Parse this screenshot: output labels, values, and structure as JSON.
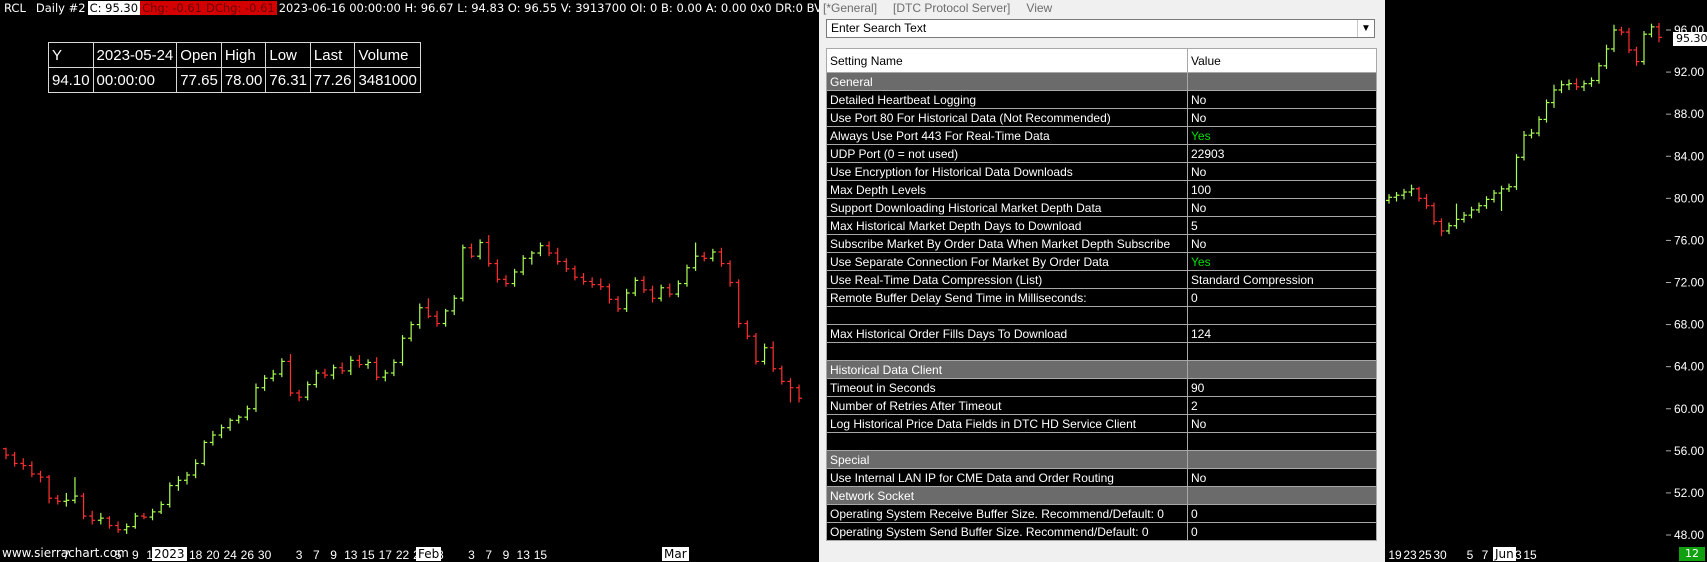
{
  "header": {
    "symbol": "RCL",
    "chart_label": "Daily #2",
    "close": "C: 95.30",
    "change": "Chg: -0.61",
    "dchange": "DChg: -0.61",
    "stats": "2023-06-16 00:00:00 H: 96.67 L: 94.83 O: 96.55 V: 3913700 OI: 0 B: 0.00 A: 0.00 0x0 DR:0 BV: 0 AV: 0 DV: 0"
  },
  "data_box": {
    "headers": [
      "Y",
      "2023-05-24",
      "Open",
      "High",
      "Low",
      "Last",
      "Volume"
    ],
    "values": [
      "94.10",
      "00:00:00",
      "77.65",
      "78.00",
      "76.31",
      "77.26",
      "3481000"
    ]
  },
  "watermark": "www.sierrachart.com",
  "highlighted_labels": {
    "year": "2023",
    "feb": "Feb",
    "mar": "Mar",
    "jun": "Jun"
  },
  "badge": "12",
  "current_price": "95.30",
  "colors": {
    "up": "#aaff55",
    "down": "#ff3030",
    "neg_bg": "#d40000",
    "yes": "#00e000",
    "section": "#6b6b6b"
  },
  "chart_data": {
    "type": "bar",
    "ylim": [
      46,
      98
    ],
    "y_ticks": [
      "96.00",
      "92.00",
      "88.00",
      "84.00",
      "80.00",
      "76.00",
      "72.00",
      "68.00",
      "64.00",
      "60.00",
      "56.00",
      "52.00",
      "48.00"
    ],
    "x_tick_labels": [
      {
        "label": "7",
        "at": 7
      },
      {
        "label": "2023",
        "at": 10
      },
      {
        "label": "5",
        "at": 13
      },
      {
        "label": "9",
        "at": 15
      },
      {
        "label": "11",
        "at": 17
      },
      {
        "label": "13",
        "at": 19
      },
      {
        "label": "18",
        "at": 22
      },
      {
        "label": "20",
        "at": 24
      },
      {
        "label": "24",
        "at": 26
      },
      {
        "label": "26",
        "at": 28
      },
      {
        "label": "30",
        "at": 30
      },
      {
        "label": "Feb",
        "at": 32
      },
      {
        "label": "3",
        "at": 34
      },
      {
        "label": "7",
        "at": 36
      },
      {
        "label": "9",
        "at": 38
      },
      {
        "label": "13",
        "at": 40
      },
      {
        "label": "15",
        "at": 42
      },
      {
        "label": "17",
        "at": 44
      },
      {
        "label": "22",
        "at": 46
      },
      {
        "label": "24",
        "at": 48
      },
      {
        "label": "28",
        "at": 50
      },
      {
        "label": "Mar",
        "at": 52
      },
      {
        "label": "3",
        "at": 54
      },
      {
        "label": "7",
        "at": 56
      },
      {
        "label": "9",
        "at": 58
      },
      {
        "label": "13",
        "at": 60
      },
      {
        "label": "15",
        "at": 62
      },
      {
        "label": "19",
        "at": 118
      },
      {
        "label": "23",
        "at": 120
      },
      {
        "label": "25",
        "at": 122
      },
      {
        "label": "30",
        "at": 124
      },
      {
        "label": "Jun",
        "at": 126
      },
      {
        "label": "5",
        "at": 128
      },
      {
        "label": "7",
        "at": 130
      },
      {
        "label": "9",
        "at": 132
      },
      {
        "label": "13",
        "at": 134
      },
      {
        "label": "15",
        "at": 136
      }
    ],
    "ohlc_left": [
      [
        56.2,
        56.3,
        55.2,
        55.6
      ],
      [
        55.6,
        55.9,
        54.5,
        54.8
      ],
      [
        54.8,
        55.3,
        54.2,
        54.6
      ],
      [
        54.6,
        55.0,
        53.5,
        53.8
      ],
      [
        53.8,
        54.1,
        53.0,
        53.5
      ],
      [
        53.5,
        53.7,
        51.0,
        51.5
      ],
      [
        51.5,
        51.8,
        50.9,
        51.2
      ],
      [
        51.2,
        52.0,
        50.7,
        51.3
      ],
      [
        51.3,
        53.5,
        51.0,
        51.7
      ],
      [
        51.7,
        52.0,
        49.5,
        49.8
      ],
      [
        49.8,
        50.3,
        49.0,
        49.4
      ],
      [
        49.4,
        50.1,
        49.0,
        49.6
      ],
      [
        49.6,
        49.8,
        48.6,
        48.9
      ],
      [
        48.9,
        49.3,
        48.2,
        48.5
      ],
      [
        48.5,
        49.1,
        48.1,
        48.8
      ],
      [
        48.8,
        50.1,
        48.6,
        49.8
      ],
      [
        49.8,
        50.1,
        49.5,
        49.7
      ],
      [
        49.7,
        50.5,
        49.4,
        50.2
      ],
      [
        50.2,
        51.2,
        50.0,
        50.9
      ],
      [
        50.9,
        53.0,
        50.6,
        52.7
      ],
      [
        52.7,
        53.6,
        52.2,
        53.2
      ],
      [
        53.2,
        54.0,
        52.8,
        53.7
      ],
      [
        53.7,
        55.2,
        53.4,
        54.8
      ],
      [
        54.8,
        57.0,
        54.6,
        56.8
      ],
      [
        56.8,
        57.9,
        56.5,
        57.5
      ],
      [
        57.5,
        58.5,
        57.2,
        58.2
      ],
      [
        58.2,
        59.1,
        57.9,
        58.9
      ],
      [
        58.9,
        59.4,
        58.6,
        59.2
      ],
      [
        59.2,
        60.3,
        58.9,
        60.0
      ],
      [
        60.0,
        62.4,
        59.7,
        62.0
      ],
      [
        62.0,
        63.2,
        61.7,
        62.9
      ],
      [
        62.9,
        63.7,
        62.6,
        63.3
      ],
      [
        63.3,
        64.8,
        63.0,
        64.5
      ],
      [
        64.5,
        65.2,
        61.2,
        61.5
      ],
      [
        61.5,
        61.8,
        60.7,
        61.1
      ],
      [
        61.1,
        62.6,
        60.8,
        62.3
      ],
      [
        62.3,
        63.7,
        62.0,
        63.4
      ],
      [
        63.4,
        63.8,
        62.9,
        63.2
      ],
      [
        63.2,
        64.2,
        62.8,
        63.9
      ],
      [
        63.9,
        64.4,
        63.3,
        63.6
      ],
      [
        63.6,
        65.0,
        63.2,
        64.6
      ],
      [
        64.6,
        65.1,
        63.9,
        64.2
      ],
      [
        64.2,
        64.7,
        63.8,
        64.4
      ],
      [
        64.4,
        64.9,
        62.7,
        63.0
      ],
      [
        63.0,
        63.7,
        62.6,
        63.4
      ],
      [
        63.4,
        64.7,
        63.1,
        64.4
      ],
      [
        64.4,
        67.0,
        64.1,
        66.7
      ],
      [
        66.7,
        68.3,
        66.4,
        68.0
      ],
      [
        68.0,
        70.0,
        67.6,
        69.6
      ],
      [
        69.6,
        70.5,
        68.6,
        68.8
      ],
      [
        68.8,
        69.3,
        67.8,
        68.1
      ],
      [
        68.1,
        69.5,
        67.8,
        69.3
      ],
      [
        69.3,
        70.8,
        68.9,
        70.5
      ],
      [
        70.5,
        75.6,
        70.2,
        75.3
      ],
      [
        75.3,
        75.7,
        74.3,
        74.5
      ],
      [
        74.5,
        76.1,
        74.2,
        75.8
      ],
      [
        75.8,
        76.5,
        73.5,
        73.8
      ],
      [
        73.8,
        74.2,
        72.0,
        72.3
      ],
      [
        72.3,
        72.7,
        71.6,
        71.9
      ],
      [
        71.9,
        73.3,
        71.6,
        73.0
      ],
      [
        73.0,
        74.6,
        72.7,
        74.3
      ],
      [
        74.3,
        75.0,
        73.7,
        74.8
      ],
      [
        74.8,
        75.8,
        74.5,
        75.5
      ],
      [
        75.5,
        75.9,
        74.5,
        74.8
      ],
      [
        74.8,
        75.3,
        73.7,
        74.0
      ],
      [
        74.0,
        74.3,
        73.0,
        73.3
      ],
      [
        73.3,
        73.6,
        72.2,
        72.5
      ],
      [
        72.5,
        72.9,
        71.8,
        72.1
      ],
      [
        72.1,
        72.5,
        71.5,
        71.8
      ],
      [
        71.8,
        72.4,
        71.3,
        71.6
      ],
      [
        71.6,
        71.9,
        70.0,
        70.4
      ],
      [
        70.4,
        70.7,
        69.2,
        69.5
      ],
      [
        69.5,
        71.4,
        69.2,
        71.0
      ],
      [
        71.0,
        72.5,
        70.7,
        72.2
      ],
      [
        72.2,
        72.6,
        71.0,
        71.3
      ],
      [
        71.3,
        71.7,
        70.1,
        70.5
      ],
      [
        70.5,
        71.8,
        70.2,
        71.5
      ],
      [
        71.5,
        71.9,
        70.6,
        70.9
      ],
      [
        70.9,
        72.2,
        70.6,
        71.9
      ],
      [
        71.9,
        73.7,
        71.6,
        73.4
      ],
      [
        73.4,
        75.8,
        73.1,
        74.5
      ],
      [
        74.5,
        74.9,
        74.0,
        74.3
      ],
      [
        74.3,
        75.2,
        74.0,
        74.9
      ],
      [
        74.9,
        75.3,
        73.5,
        73.8
      ],
      [
        73.8,
        74.1,
        71.6,
        72.0
      ],
      [
        72.0,
        72.3,
        67.7,
        68.1
      ],
      [
        68.1,
        68.4,
        66.6,
        66.9
      ],
      [
        66.9,
        67.2,
        64.2,
        64.5
      ],
      [
        64.5,
        66.2,
        64.2,
        65.8
      ],
      [
        65.8,
        66.4,
        63.5,
        63.8
      ],
      [
        63.8,
        64.1,
        62.3,
        62.6
      ],
      [
        62.6,
        62.9,
        60.6,
        62.0
      ],
      [
        62.0,
        62.3,
        60.6,
        61.0
      ]
    ],
    "ohlc_right": [
      [
        79.8,
        80.4,
        79.5,
        80.1
      ],
      [
        80.1,
        80.6,
        79.7,
        80.3
      ],
      [
        80.3,
        80.9,
        79.9,
        80.6
      ],
      [
        80.6,
        81.3,
        80.2,
        80.9
      ],
      [
        80.9,
        81.1,
        79.7,
        80.0
      ],
      [
        80.0,
        80.4,
        79.0,
        79.3
      ],
      [
        79.3,
        79.6,
        77.5,
        77.8
      ],
      [
        77.8,
        78.1,
        76.4,
        76.9
      ],
      [
        76.9,
        77.7,
        76.6,
        77.4
      ],
      [
        77.4,
        79.5,
        77.1,
        78.0
      ],
      [
        78.0,
        78.7,
        77.7,
        78.4
      ],
      [
        78.4,
        79.2,
        78.1,
        78.9
      ],
      [
        78.9,
        79.6,
        78.6,
        79.3
      ],
      [
        79.3,
        80.2,
        79.0,
        79.9
      ],
      [
        79.9,
        80.8,
        79.6,
        80.5
      ],
      [
        80.5,
        81.2,
        78.8,
        80.9
      ],
      [
        80.9,
        81.4,
        80.6,
        81.1
      ],
      [
        81.1,
        84.2,
        80.8,
        83.9
      ],
      [
        83.9,
        86.4,
        83.6,
        86.0
      ],
      [
        86.0,
        86.6,
        85.7,
        86.2
      ],
      [
        86.2,
        87.8,
        85.9,
        87.5
      ],
      [
        87.5,
        89.4,
        87.2,
        89.1
      ],
      [
        89.1,
        90.8,
        88.6,
        90.3
      ],
      [
        90.3,
        91.2,
        90.0,
        90.8
      ],
      [
        90.8,
        91.3,
        90.3,
        90.9
      ],
      [
        90.9,
        91.4,
        90.3,
        90.6
      ],
      [
        90.6,
        91.2,
        90.2,
        90.9
      ],
      [
        90.9,
        91.5,
        90.6,
        91.2
      ],
      [
        91.2,
        92.9,
        90.9,
        92.6
      ],
      [
        92.6,
        94.6,
        92.3,
        94.2
      ],
      [
        94.2,
        96.5,
        93.9,
        96.0
      ],
      [
        96.0,
        96.3,
        95.5,
        95.8
      ],
      [
        95.8,
        96.2,
        93.8,
        94.1
      ],
      [
        94.1,
        94.4,
        92.6,
        93.0
      ],
      [
        93.0,
        95.9,
        92.7,
        95.6
      ],
      [
        95.6,
        96.6,
        95.3,
        96.3
      ],
      [
        96.3,
        96.67,
        94.83,
        95.3
      ]
    ]
  },
  "panel": {
    "menu": [
      "[*General]",
      "[DTC Protocol Server]",
      "View"
    ],
    "search_placeholder": "Enter Search Text",
    "col_name": "Setting Name",
    "col_value": "Value",
    "rows": [
      {
        "type": "section",
        "name": "General",
        "value": ""
      },
      {
        "type": "row",
        "name": "Detailed Heartbeat Logging",
        "value": "No"
      },
      {
        "type": "row",
        "name": "Use Port 80 For Historical Data (Not Recommended)",
        "value": "No"
      },
      {
        "type": "row",
        "name": "Always Use Port 443 For Real-Time Data",
        "value": "Yes"
      },
      {
        "type": "row",
        "name": "UDP Port (0 = not used)",
        "value": "22903"
      },
      {
        "type": "row",
        "name": "Use Encryption for Historical Data Downloads",
        "value": "No"
      },
      {
        "type": "row",
        "name": "Max Depth Levels",
        "value": "100"
      },
      {
        "type": "row",
        "name": "Support Downloading Historical Market Depth Data",
        "value": "No"
      },
      {
        "type": "row",
        "name": "Max Historical Market Depth Days to Download",
        "value": "5"
      },
      {
        "type": "row",
        "name": "Subscribe Market By Order Data When Market Depth Subscribe",
        "value": "No"
      },
      {
        "type": "row",
        "name": "Use Separate Connection For Market By Order Data",
        "value": "Yes"
      },
      {
        "type": "row",
        "name": "Use Real-Time Data Compression (List)",
        "value": "Standard Compression"
      },
      {
        "type": "row",
        "name": "Remote Buffer Delay Send Time in Milliseconds:",
        "value": "0"
      },
      {
        "type": "blank",
        "name": "",
        "value": ""
      },
      {
        "type": "row",
        "name": "Max Historical Order Fills Days To Download",
        "value": "124"
      },
      {
        "type": "blank",
        "name": "",
        "value": ""
      },
      {
        "type": "section",
        "name": "Historical Data Client",
        "value": ""
      },
      {
        "type": "row",
        "name": "Timeout in Seconds",
        "value": "90"
      },
      {
        "type": "row",
        "name": "Number of Retries After Timeout",
        "value": "2"
      },
      {
        "type": "row",
        "name": "Log Historical Price Data Fields in DTC HD Service Client",
        "value": "No"
      },
      {
        "type": "blank",
        "name": "",
        "value": ""
      },
      {
        "type": "section",
        "name": "Special",
        "value": ""
      },
      {
        "type": "row",
        "name": "Use Internal LAN IP for CME Data and Order Routing",
        "value": "No"
      },
      {
        "type": "section",
        "name": "Network Socket",
        "value": ""
      },
      {
        "type": "row",
        "name": "Operating System Receive Buffer Size. Recommend/Default: 0",
        "value": "0"
      },
      {
        "type": "row",
        "name": "Operating System Send Buffer Size. Recommend/Default: 0",
        "value": "0"
      }
    ]
  }
}
